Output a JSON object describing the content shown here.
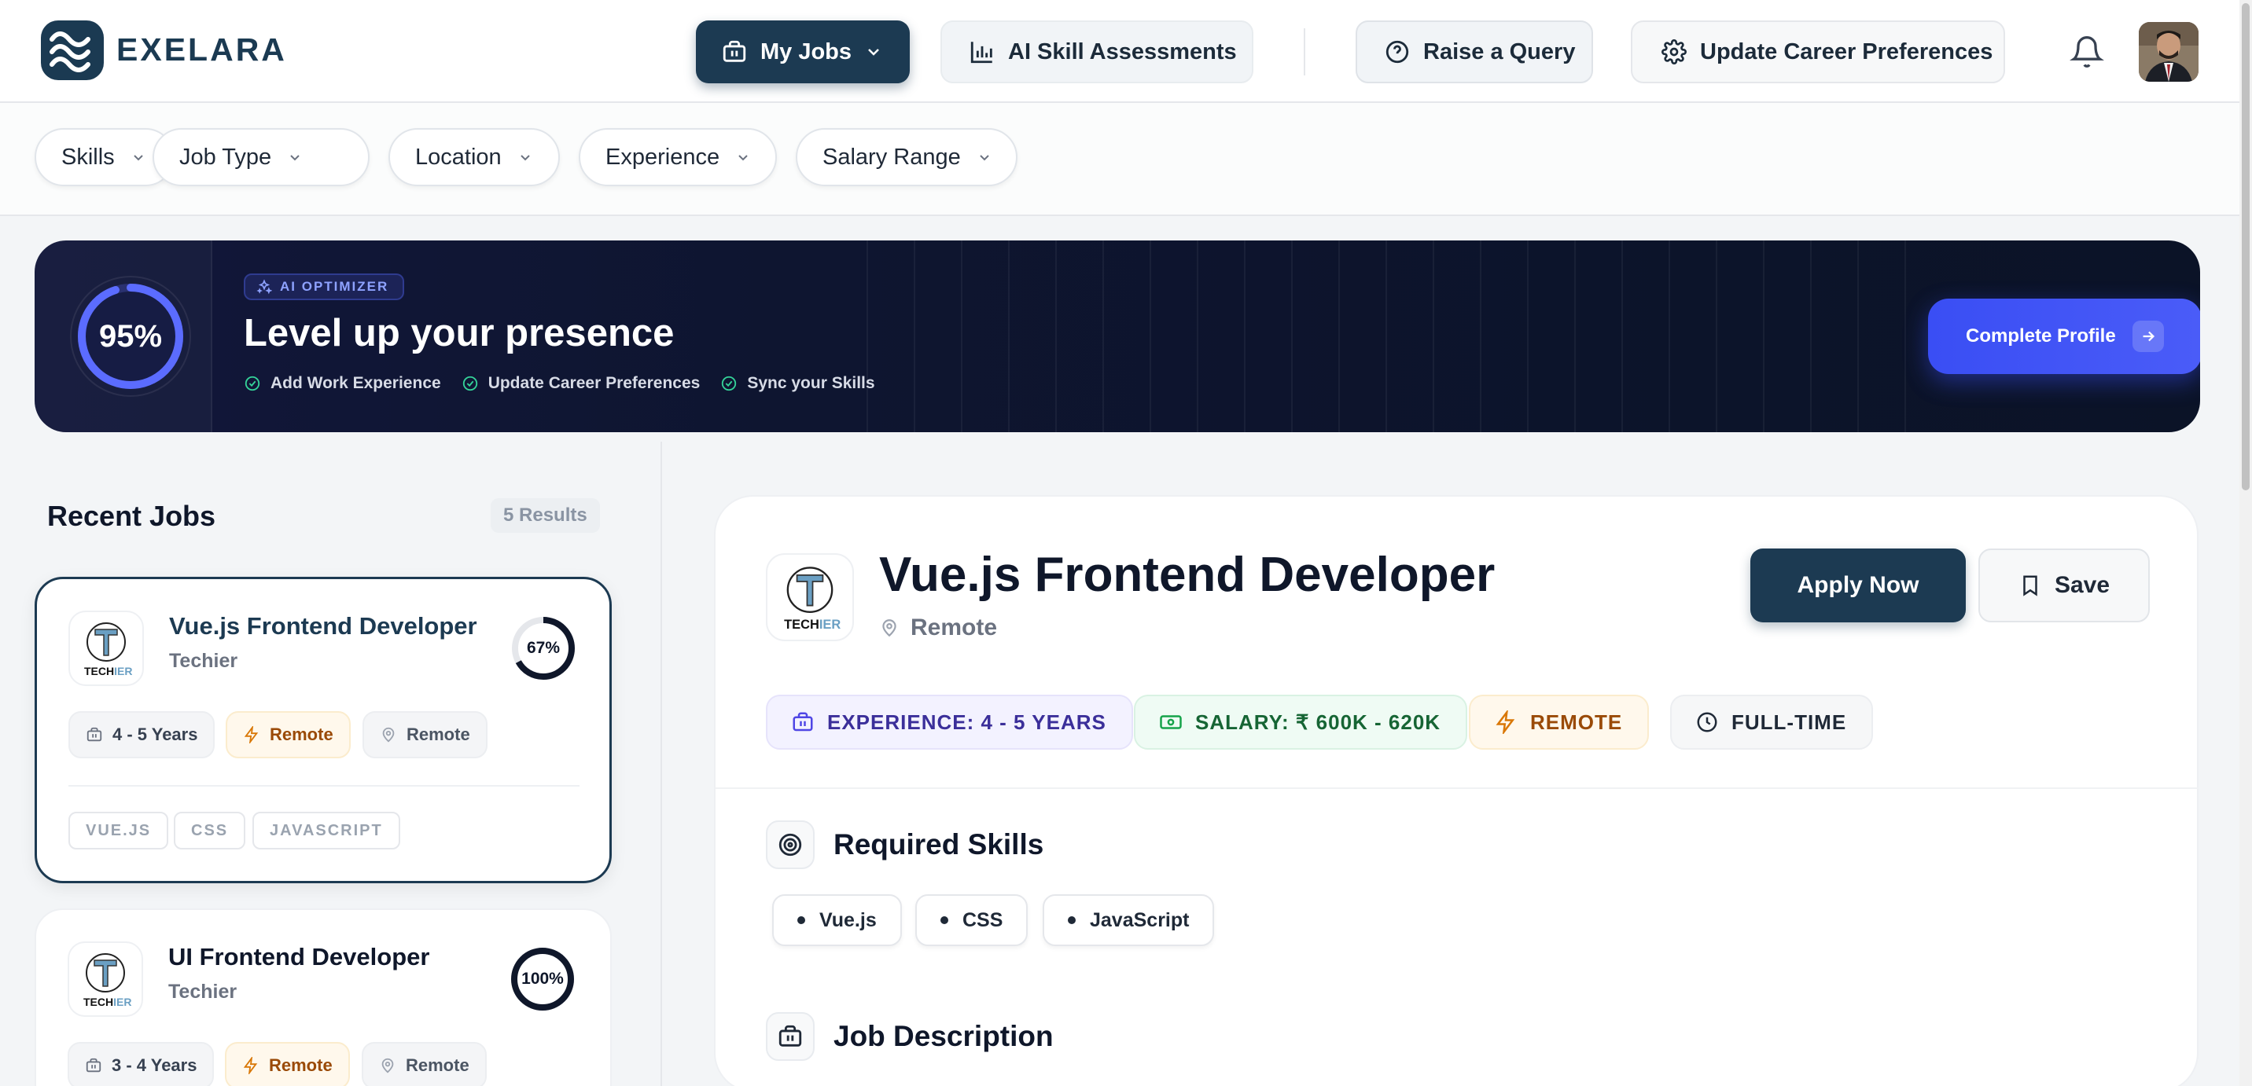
{
  "header": {
    "brand": "EXELARA",
    "nav": [
      {
        "label": "My Jobs",
        "icon": "briefcase-icon"
      },
      {
        "label": "AI Skill Assessments",
        "icon": "bar-chart-icon"
      },
      {
        "label": "Raise a Query",
        "icon": "help-circle-icon"
      },
      {
        "label": "Update Career Preferences",
        "icon": "gear-icon"
      }
    ]
  },
  "filters": [
    "Skills",
    "Job Type",
    "Location",
    "Experience",
    "Salary Range"
  ],
  "banner": {
    "score": "95%",
    "score_fraction": 0.95,
    "badge": "AI OPTIMIZER",
    "title": "Level up your presence",
    "checks": [
      "Add Work Experience",
      "Update Career Preferences",
      "Sync your Skills"
    ],
    "cta": "Complete Profile"
  },
  "jobs_list": {
    "heading": "Recent Jobs",
    "results": "5 Results",
    "items": [
      {
        "title": "Vue.js Frontend Developer",
        "company": "Techier",
        "match": "67%",
        "match_fraction": 0.67,
        "experience": "4 - 5 Years",
        "mode": "Remote",
        "location": "Remote",
        "tags": [
          "VUE.JS",
          "CSS",
          "JAVASCRIPT"
        ]
      },
      {
        "title": "UI Frontend Developer",
        "company": "Techier",
        "match": "100%",
        "match_fraction": 1.0,
        "experience": "3 - 4 Years",
        "mode": "Remote",
        "location": "Remote"
      }
    ]
  },
  "detail": {
    "title": "Vue.js Frontend Developer",
    "location": "Remote",
    "apply": "Apply Now",
    "save": "Save",
    "chips": {
      "experience": "EXPERIENCE: 4 - 5 YEARS",
      "salary": "SALARY: ₹ 600K - 620K",
      "mode": "REMOTE",
      "type": "FULL-TIME"
    },
    "skills_heading": "Required Skills",
    "skills": [
      "Vue.js",
      "CSS",
      "JavaScript"
    ],
    "description_heading": "Job Description"
  },
  "logo_text": {
    "main": "TECH",
    "accent": "IER"
  },
  "colors": {
    "primary": "#1c3a52",
    "accent": "#3a4ef4",
    "remote": "#9a4a07"
  }
}
